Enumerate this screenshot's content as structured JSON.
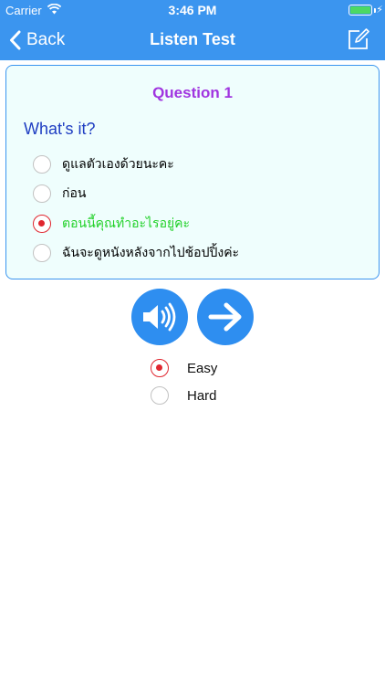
{
  "status_bar": {
    "carrier": "Carrier",
    "time": "3:46 PM"
  },
  "nav": {
    "back_label": "Back",
    "title": "Listen Test"
  },
  "question": {
    "title": "Question 1",
    "prompt": "What's it?",
    "options": [
      {
        "text": "ดูแลตัวเองด้วยนะคะ",
        "selected": false
      },
      {
        "text": "ก่อน",
        "selected": false
      },
      {
        "text": "ตอนนี้คุณทำอะไรอยู่คะ",
        "selected": true
      },
      {
        "text": "ฉันจะดูหนังหลังจากไปช้อปปิ้งค่ะ",
        "selected": false
      }
    ]
  },
  "difficulty": [
    {
      "label": "Easy",
      "selected": true
    },
    {
      "label": "Hard",
      "selected": false
    }
  ],
  "icons": {
    "back": "chevron-left-icon",
    "edit": "edit-note-icon",
    "speaker": "speaker-icon",
    "next": "arrow-right-icon"
  },
  "colors": {
    "header": "#3b95ef",
    "card_bg": "#effefd",
    "question_title": "#a035e0",
    "prompt": "#1f3ec2",
    "selected_option": "#22d12a",
    "radio_selected": "#e0262f",
    "round_button": "#2e8ef0"
  }
}
